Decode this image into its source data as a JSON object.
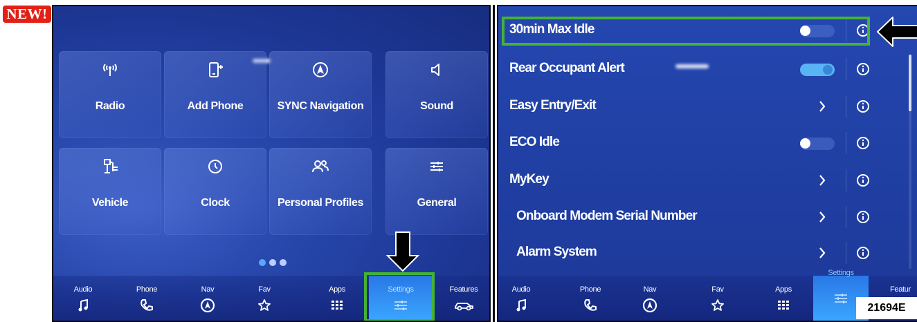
{
  "badge": "NEW!",
  "home": {
    "tiles": [
      {
        "label": "Radio",
        "icon": "radio-signal-icon"
      },
      {
        "label": "Add Phone",
        "icon": "add-phone-icon"
      },
      {
        "label": "SYNC Navigation",
        "icon": "navigation-icon"
      },
      {
        "label": "Sound",
        "icon": "speaker-icon"
      },
      {
        "label": "Vehicle",
        "icon": "vehicle-settings-icon"
      },
      {
        "label": "Clock",
        "icon": "clock-icon"
      },
      {
        "label": "Personal Profiles",
        "icon": "profiles-icon"
      },
      {
        "label": "General",
        "icon": "sliders-icon"
      }
    ],
    "pager_dots": 3,
    "pager_active": 1
  },
  "left_nav": [
    {
      "label": "Audio",
      "icon": "music-note-icon"
    },
    {
      "label": "Phone",
      "icon": "phone-icon"
    },
    {
      "label": "Nav",
      "icon": "nav-compass-icon"
    },
    {
      "label": "Fav",
      "icon": "star-icon"
    },
    {
      "label": "Apps",
      "icon": "apps-grid-icon"
    },
    {
      "label": "Settings",
      "icon": "sliders-icon",
      "active": true
    },
    {
      "label": "Features",
      "icon": "car-icon"
    }
  ],
  "settings_list": [
    {
      "label": "30min Max Idle",
      "control": "toggle",
      "state": "off"
    },
    {
      "label": "Rear Occupant Alert",
      "control": "toggle",
      "state": "on"
    },
    {
      "label": "Easy Entry/Exit",
      "control": "chevron"
    },
    {
      "label": "ECO Idle",
      "control": "toggle",
      "state": "off"
    },
    {
      "label": "MyKey",
      "control": "chevron"
    },
    {
      "label": "Onboard Modem Serial Number",
      "control": "chevron"
    },
    {
      "label": "Alarm System",
      "control": "chevron"
    }
  ],
  "right_nav": [
    {
      "label": "Audio",
      "icon": "music-note-icon"
    },
    {
      "label": "Phone",
      "icon": "phone-icon"
    },
    {
      "label": "Nav",
      "icon": "nav-compass-icon"
    },
    {
      "label": "Fav",
      "icon": "star-icon"
    },
    {
      "label": "Apps",
      "icon": "apps-grid-icon"
    },
    {
      "label": "Settings",
      "icon": "sliders-icon",
      "active": true
    },
    {
      "label": "Featur",
      "icon": "car-icon"
    }
  ],
  "reference_number": "21694E",
  "colors": {
    "highlight": "#44b335",
    "badge": "#e32016",
    "active_tab": "#3aa6ff"
  }
}
